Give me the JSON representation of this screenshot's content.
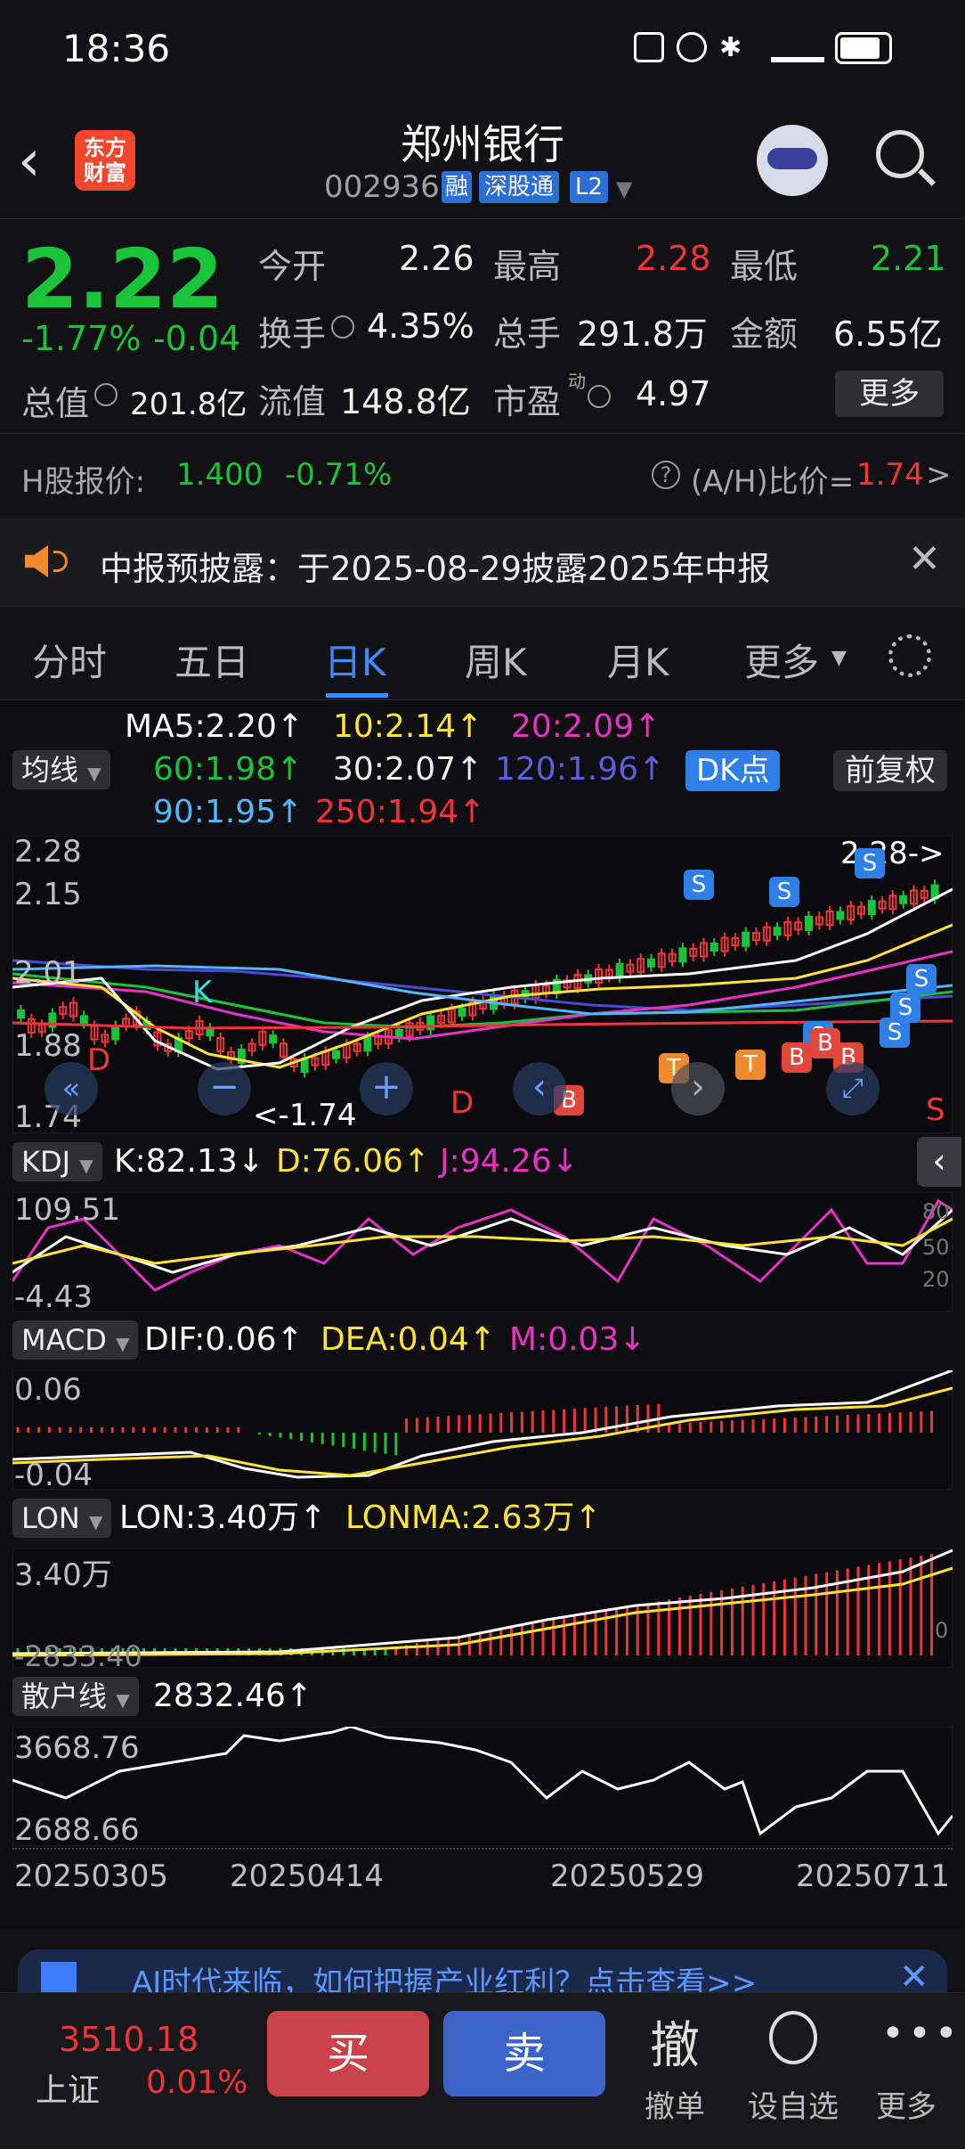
{
  "status_bar": {
    "time": "18:36"
  },
  "header": {
    "title": "郑州银行",
    "code": "002936",
    "tags": [
      "融",
      "深股通",
      "L2"
    ],
    "logo_line1": "东方",
    "logo_line2": "财富"
  },
  "quote": {
    "price": "2.22",
    "change_pct": "-1.77%",
    "change": "-0.04",
    "labels": {
      "open": "今开",
      "high": "最高",
      "low": "最低",
      "turnover": "换手",
      "volume": "总手",
      "amount": "金额",
      "mktcap": "总值",
      "float_cap": "流值",
      "pe": "市盈",
      "pe_sup": "动",
      "more": "更多"
    },
    "open": "2.26",
    "high": "2.28",
    "low": "2.21",
    "turnover_val": "4.35%",
    "volume_val": "291.8万",
    "amount_val": "6.55亿",
    "mktcap_val": "201.8亿",
    "float_val": "148.8亿",
    "pe_val": "4.97"
  },
  "hshare": {
    "label": "H股报价:",
    "price": "1.400",
    "pct": "-0.71%",
    "ratio_label": "(A/H)比价=",
    "ratio": "1.74",
    ">": ">"
  },
  "notice": {
    "text": "中报预披露：于2025-08-29披露2025年中报"
  },
  "tabs": [
    "分时",
    "五日",
    "日K",
    "周K",
    "月K",
    "更多"
  ],
  "ma": {
    "btn": "均线",
    "ma5": "MA5:2.20↑",
    "ma10": "10:2.14↑",
    "ma20": "20:2.09↑",
    "ma60": "60:1.98↑",
    "ma30": "30:2.07↑",
    "ma120": "120:1.96↑",
    "ma90": "90:1.95↑",
    "ma250": "250:1.94↑",
    "dk": "DK点",
    "fq": "前复权"
  },
  "kline": {
    "y_top": "2.28",
    "y2": "2.15",
    "y3": "2.01",
    "y4": "1.88",
    "y_bot": "1.74",
    "max_label": "2.28->",
    "min_label": "<-1.74",
    "marks": {
      "K": "K",
      "D": "D",
      "S": "S",
      "B": "B",
      "T": "T"
    }
  },
  "kdj": {
    "btn": "KDJ",
    "k": "K:82.13↓",
    "d": "D:76.06↑",
    "j": "J:94.26↓",
    "y_top": "109.51",
    "y_bot": "-4.43",
    "r80": "80",
    "r50": "50",
    "r20": "20"
  },
  "macd": {
    "btn": "MACD",
    "dif": "DIF:0.06↑",
    "dea": "DEA:0.04↑",
    "m": "M:0.03↓",
    "y_top": "0.06",
    "y_bot": "-0.04"
  },
  "lon": {
    "btn": "LON",
    "lon": "LON:3.40万↑",
    "lonma": "LONMA:2.63万↑",
    "y_top": "3.40万",
    "y_bot": "-2833.40",
    "zero": "0"
  },
  "retail": {
    "btn": "散户线",
    "val": "2832.46↑",
    "y_top": "3668.76",
    "y_bot": "2688.66"
  },
  "dates": [
    "20250305",
    "20250414",
    "20250529",
    "20250711"
  ],
  "ad": {
    "text": "AI时代来临，如何把握产业红利？点击查看>>"
  },
  "bottom": {
    "index_val": "3510.18",
    "index_name": "上证",
    "index_pct": "0.01%",
    "buy": "买",
    "sell": "卖",
    "cancel_icon": "撤",
    "cancel": "撤单",
    "watch": "设自选",
    "more": "更多"
  },
  "colors": {
    "up": "#f0353a",
    "down": "#19c43a",
    "accent": "#3d8cff",
    "bg": "#121214"
  }
}
